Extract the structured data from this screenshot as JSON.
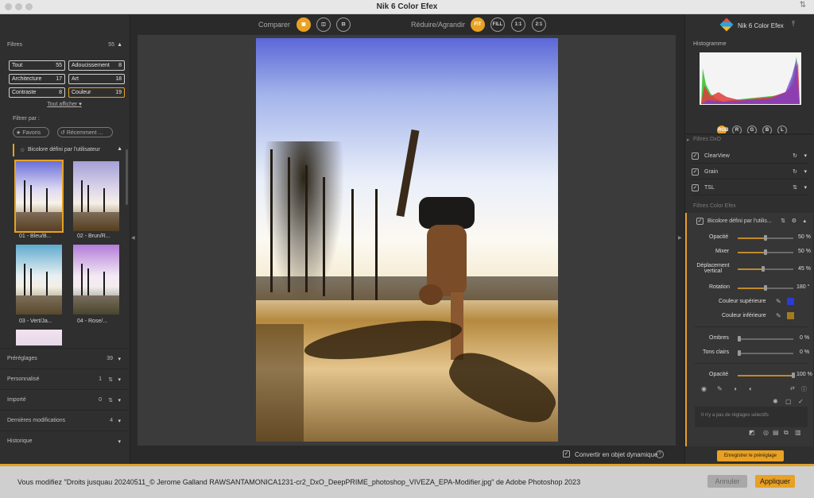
{
  "window": {
    "title": "Nik 6 Color Efex"
  },
  "left": {
    "filters_title": "Filtres",
    "filters_count": "55",
    "categories": [
      {
        "label": "Tout",
        "count": "55"
      },
      {
        "label": "Adoucissement",
        "count": "8"
      },
      {
        "label": "Architecture",
        "count": "17"
      },
      {
        "label": "Art",
        "count": "18"
      },
      {
        "label": "Contraste",
        "count": "8"
      },
      {
        "label": "Couleur",
        "count": "19"
      }
    ],
    "show_all": "Tout afficher",
    "filter_by": "Filtrer par :",
    "favorites": "Favoris",
    "recent": "Récemment ...",
    "active_filter": "Bicolore défini par l'utilisateur",
    "presets": [
      {
        "label": "01 - Bleu/B..."
      },
      {
        "label": "02 - Brun/R..."
      },
      {
        "label": "03 - Vert/Ja..."
      },
      {
        "label": "04 - Rose/..."
      }
    ],
    "sections": [
      {
        "label": "Préréglages",
        "count": "39"
      },
      {
        "label": "Personnalisé",
        "count": "1"
      },
      {
        "label": "Importé",
        "count": "0"
      },
      {
        "label": "Dernières modifications",
        "count": "4"
      },
      {
        "label": "Historique",
        "count": ""
      }
    ]
  },
  "center": {
    "compare_label": "Comparer",
    "zoom_label": "Réduire/Agrandir",
    "zoom_options": [
      "FIT",
      "FILL",
      "1:1",
      "2:1"
    ],
    "zoom_selected": "FIT",
    "convert_label": "Convertir en objet dynamique",
    "help_icon": "?"
  },
  "right": {
    "brand": "Nik 6 Color Efex",
    "histogram_title": "Histogramme",
    "histogram_channels": [
      "RGB",
      "R",
      "G",
      "B",
      "L"
    ],
    "dxo_filters_title": "Filtres DxO",
    "dxo_filters": [
      {
        "label": "ClearView"
      },
      {
        "label": "Grain"
      },
      {
        "label": "TSL"
      }
    ],
    "color_efex_title": "Filtres Color Efex",
    "active_filter": "Bicolore défini par l'utilis...",
    "params": [
      {
        "label": "Opacité",
        "value": "50 %",
        "level": 0.5
      },
      {
        "label": "Mixer",
        "value": "50 %",
        "level": 0.5
      },
      {
        "label": "Déplacement vertical",
        "value": "45 %",
        "level": 0.45
      },
      {
        "label": "Rotation",
        "value": "180 °",
        "level": 0.5
      }
    ],
    "upper_color_label": "Couleur supérieure",
    "upper_color": "#2b3bd6",
    "lower_color_label": "Couleur inférieure",
    "lower_color": "#a27a20",
    "tone_params": [
      {
        "label": "Ombres",
        "value": "0 %",
        "level": 0
      },
      {
        "label": "Tons clairs",
        "value": "0 %",
        "level": 0
      }
    ],
    "global_opacity_label": "Opacité",
    "global_opacity_value": "100 %",
    "global_opacity_level": 1.0,
    "no_selective": "Il n'y a pas de réglages sélectifs",
    "save_preset": "Enregistrer le préréglage"
  },
  "footer": {
    "message": "Vous modifiez \"Droits jusquau 20240511_© Jerome Galland RAWSANTAMONICA1231-cr2_DxO_DeepPRIME_photoshop_VIVEZA_EPA-Modifier.jpg\" de Adobe Photoshop 2023",
    "cancel": "Annuler",
    "apply": "Appliquer"
  },
  "colors": {
    "accent": "#e8a125"
  }
}
